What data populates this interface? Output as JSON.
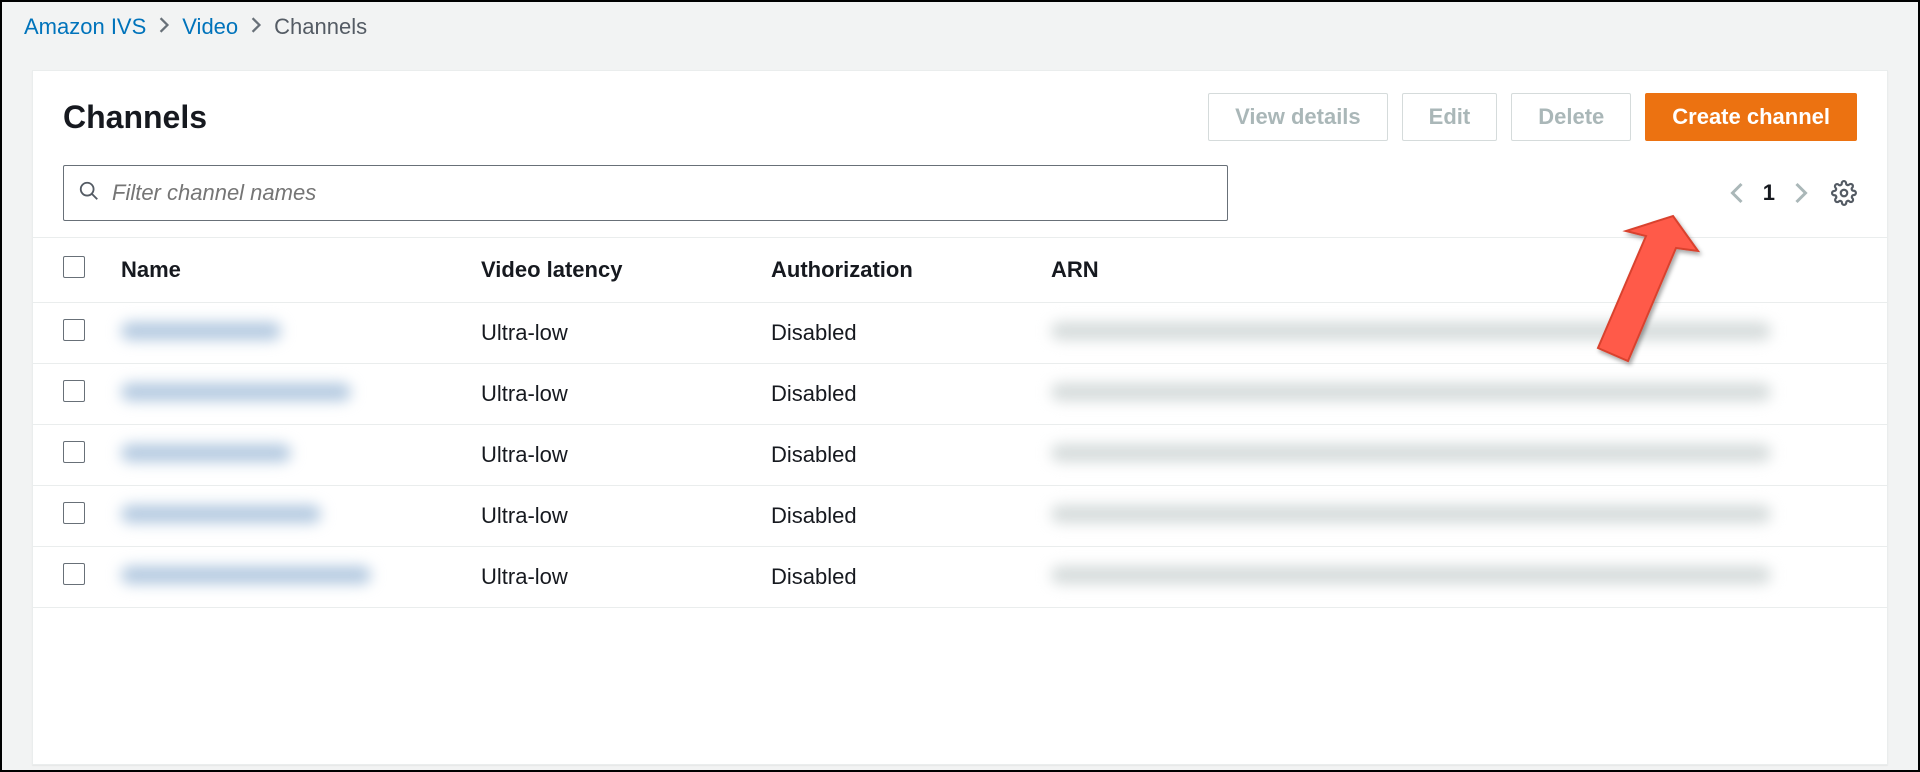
{
  "breadcrumb": {
    "items": [
      {
        "label": "Amazon IVS",
        "link": true
      },
      {
        "label": "Video",
        "link": true
      },
      {
        "label": "Channels",
        "link": false
      }
    ]
  },
  "panel": {
    "title": "Channels"
  },
  "actions": {
    "view_details": "View details",
    "edit": "Edit",
    "delete": "Delete",
    "create_channel": "Create channel"
  },
  "filter": {
    "placeholder": "Filter channel names"
  },
  "pagination": {
    "page": "1"
  },
  "table": {
    "headers": {
      "name": "Name",
      "latency": "Video latency",
      "auth": "Authorization",
      "arn": "ARN"
    },
    "rows": [
      {
        "latency": "Ultra-low",
        "auth": "Disabled"
      },
      {
        "latency": "Ultra-low",
        "auth": "Disabled"
      },
      {
        "latency": "Ultra-low",
        "auth": "Disabled"
      },
      {
        "latency": "Ultra-low",
        "auth": "Disabled"
      },
      {
        "latency": "Ultra-low",
        "auth": "Disabled"
      }
    ]
  }
}
